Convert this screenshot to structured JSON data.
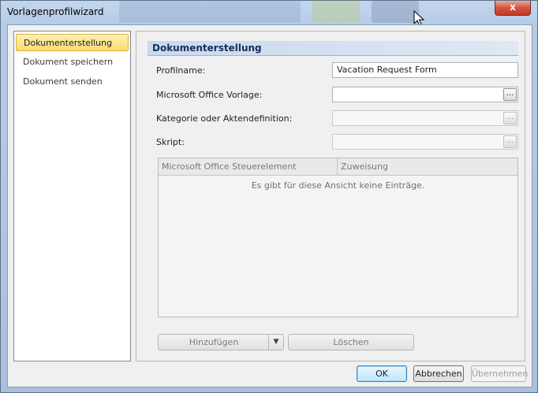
{
  "window": {
    "title": "Vorlagenprofilwizard",
    "close_label": "x"
  },
  "nav": {
    "items": [
      {
        "label": "Dokumenterstellung",
        "active": true
      },
      {
        "label": "Dokument speichern",
        "active": false
      },
      {
        "label": "Dokument senden",
        "active": false
      }
    ]
  },
  "content": {
    "section_title": "Dokumenterstellung",
    "fields": {
      "profile_name": {
        "label": "Profilname:",
        "value": "Vacation Request Form"
      },
      "office_template": {
        "label": "Microsoft Office Vorlage:",
        "value": "",
        "browse_label": "..."
      },
      "category": {
        "label": "Kategorie oder Aktendefinition:",
        "value": "",
        "browse_label": "..."
      },
      "script": {
        "label": "Skript:",
        "value": "",
        "browse_label": "..."
      }
    },
    "grid": {
      "columns": [
        "Microsoft Office Steuerelement",
        "Zuweisung"
      ],
      "rows": [],
      "empty_text": "Es gibt für diese Ansicht keine Einträge."
    },
    "add_label": "Hinzufügen",
    "add_arrow": "▼",
    "delete_label": "Löschen"
  },
  "footer": {
    "ok_label": "OK",
    "cancel_label": "Abbrechen",
    "apply_label": "Übernehmen"
  },
  "colors": {
    "accent": "#15305a",
    "selection": "#f9dc6e"
  },
  "icons": {
    "close": "close-icon",
    "cursor": "mouse-pointer-icon",
    "browse": "ellipsis-icon"
  }
}
